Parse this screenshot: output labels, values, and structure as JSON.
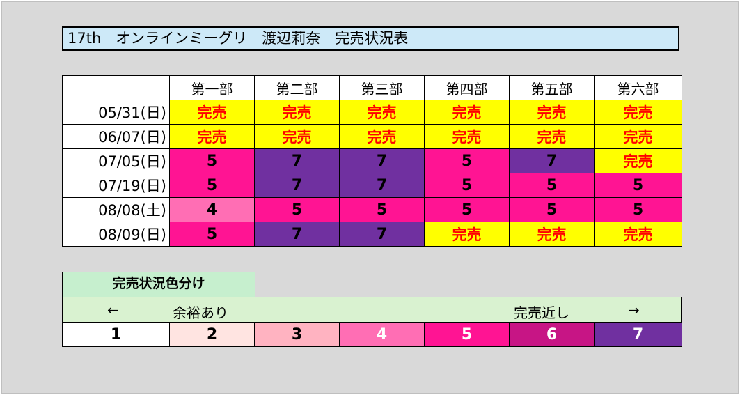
{
  "title": "17th　オンラインミーグリ　渡辺莉奈　完売状況表",
  "sold_out_label": "完売",
  "parts": [
    "第一部",
    "第二部",
    "第三部",
    "第四部",
    "第五部",
    "第六部"
  ],
  "rows": [
    {
      "date": "05/31(日)",
      "cells": [
        "sold",
        "sold",
        "sold",
        "sold",
        "sold",
        "sold"
      ]
    },
    {
      "date": "06/07(日)",
      "cells": [
        "sold",
        "sold",
        "sold",
        "sold",
        "sold",
        "sold"
      ]
    },
    {
      "date": "07/05(日)",
      "cells": [
        "5",
        "7",
        "7",
        "5",
        "7",
        "sold"
      ]
    },
    {
      "date": "07/19(日)",
      "cells": [
        "5",
        "7",
        "7",
        "5",
        "5",
        "5"
      ]
    },
    {
      "date": "08/08(土)",
      "cells": [
        "4",
        "5",
        "5",
        "5",
        "5",
        "5"
      ]
    },
    {
      "date": "08/09(日)",
      "cells": [
        "5",
        "7",
        "7",
        "sold",
        "sold",
        "sold"
      ]
    }
  ],
  "legend": {
    "title": "完売状況色分け",
    "left_arrow": "←",
    "left_label": "余裕あり",
    "right_label": "完売近し",
    "right_arrow": "→",
    "levels": [
      {
        "value": "1",
        "bg": "#ffffff",
        "fg": "#000000"
      },
      {
        "value": "2",
        "bg": "#ffe4e1",
        "fg": "#000000"
      },
      {
        "value": "3",
        "bg": "#ffb3c1",
        "fg": "#000000"
      },
      {
        "value": "4",
        "bg": "#ff6eb4",
        "fg": "#ffffff"
      },
      {
        "value": "5",
        "bg": "#ff1493",
        "fg": "#ffffff"
      },
      {
        "value": "6",
        "bg": "#c71585",
        "fg": "#ffffff"
      },
      {
        "value": "7",
        "bg": "#7030a0",
        "fg": "#ffffff"
      }
    ]
  },
  "cell_colors": {
    "sold_bg": "#ffff00",
    "sold_fg": "#ff0000",
    "4": "#ff6eb4",
    "5": "#ff1493",
    "7": "#7030a0"
  }
}
